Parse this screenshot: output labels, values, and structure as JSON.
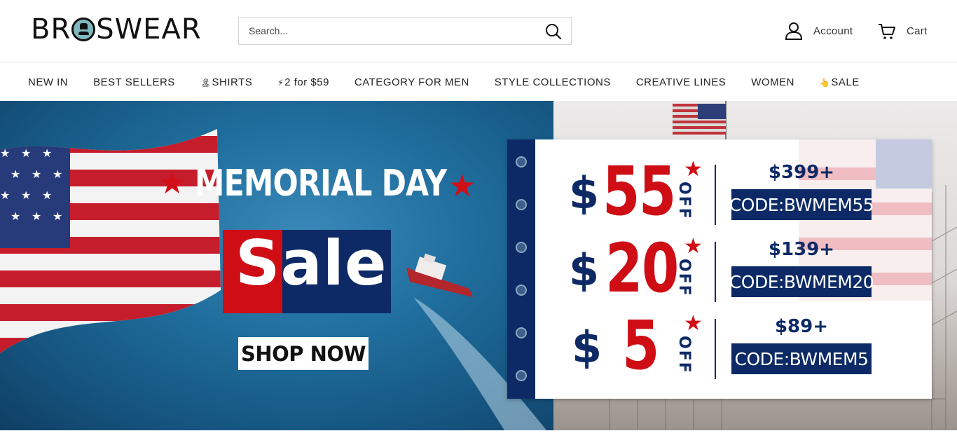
{
  "header": {
    "logo_text": "BROSWEAR",
    "search": {
      "placeholder": "Search..."
    },
    "account_label": "Account",
    "cart_label": "Cart"
  },
  "nav": {
    "items": [
      {
        "label": "NEW IN",
        "emoji": ""
      },
      {
        "label": "BEST SELLERS",
        "emoji": ""
      },
      {
        "label": "SHIRTS",
        "emoji": "🏝"
      },
      {
        "label": "2 for $59",
        "emoji": "⚡"
      },
      {
        "label": "CATEGORY FOR MEN",
        "emoji": ""
      },
      {
        "label": "STYLE COLLECTIONS",
        "emoji": ""
      },
      {
        "label": "CREATIVE LINES",
        "emoji": ""
      },
      {
        "label": "WOMEN",
        "emoji": ""
      },
      {
        "label": "SALE",
        "emoji": "👆"
      }
    ]
  },
  "hero": {
    "title": "MEMORIAL DAY",
    "sale_word": "Sale",
    "cta_label": "SHOP NOW",
    "offers": [
      {
        "currency": "$",
        "amount": "55",
        "off": "OFF",
        "threshold": "$399+",
        "code": "CODE:BWMEM55"
      },
      {
        "currency": "$",
        "amount": "20",
        "off": "OFF",
        "threshold": "$139+",
        "code": "CODE:BWMEM20"
      },
      {
        "currency": "$",
        "amount": "5",
        "off": "OFF",
        "threshold": "$89+",
        "code": "CODE:BWMEM5"
      }
    ]
  },
  "colors": {
    "brand_navy": "#0d2a66",
    "brand_red": "#cf0d14",
    "sea_blue": "#1f6d9c"
  },
  "icons": {
    "search": "search-icon",
    "account": "user-icon",
    "cart": "cart-icon"
  }
}
